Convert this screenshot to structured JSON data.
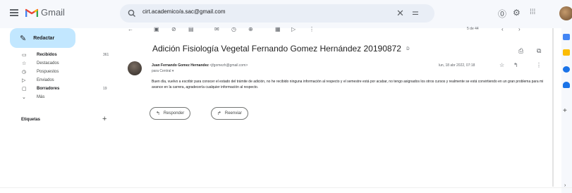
{
  "app": {
    "name": "Gmail"
  },
  "search": {
    "value": "cirt.academico/a.sac@gmail.com"
  },
  "compose": {
    "label": "Redactar"
  },
  "nav": {
    "items": [
      {
        "label": "Recibidos",
        "count": "361",
        "icon": "inbox-icon",
        "bold": true
      },
      {
        "label": "Destacados",
        "count": "",
        "icon": "star-icon",
        "bold": false
      },
      {
        "label": "Pospuestos",
        "count": "",
        "icon": "clock-icon",
        "bold": false
      },
      {
        "label": "Enviados",
        "count": "",
        "icon": "send-icon",
        "bold": false
      },
      {
        "label": "Borradores",
        "count": "19",
        "icon": "draft-icon",
        "bold": true
      },
      {
        "label": "Más",
        "count": "",
        "icon": "chevron-down-icon",
        "bold": false
      }
    ],
    "labels_heading": "Etiquetas"
  },
  "toolbar": {
    "pagination": "5 de 44"
  },
  "email": {
    "subject": "Adición Fisiología Vegetal Fernando Gomez Hernández 20190872",
    "tag": "D",
    "sender_name": "Juan Fernando Gomez Hernandez",
    "sender_email": "<jfgomezh@gmail.com>",
    "to": "para Central ▾",
    "date": "lun, 18 abr 2022, 07:18",
    "body": "Buen día, vuelvo a escribir para conocer el estado del trámite de adición, no he recibido ninguna información al respecto y el semestre está por acabar, no tengo asignados los otros cursos y realmente se está convirtiendo en un gran problema para mi avance en la carrera, agradecería cualquier información al respecto."
  },
  "actions": {
    "reply_label": "Responder",
    "forward_label": "Reenviar"
  },
  "colors": {
    "compose_bg": "#c2e7ff",
    "search_bg": "#e9eef6",
    "shell_bg": "#f6f8fc"
  }
}
